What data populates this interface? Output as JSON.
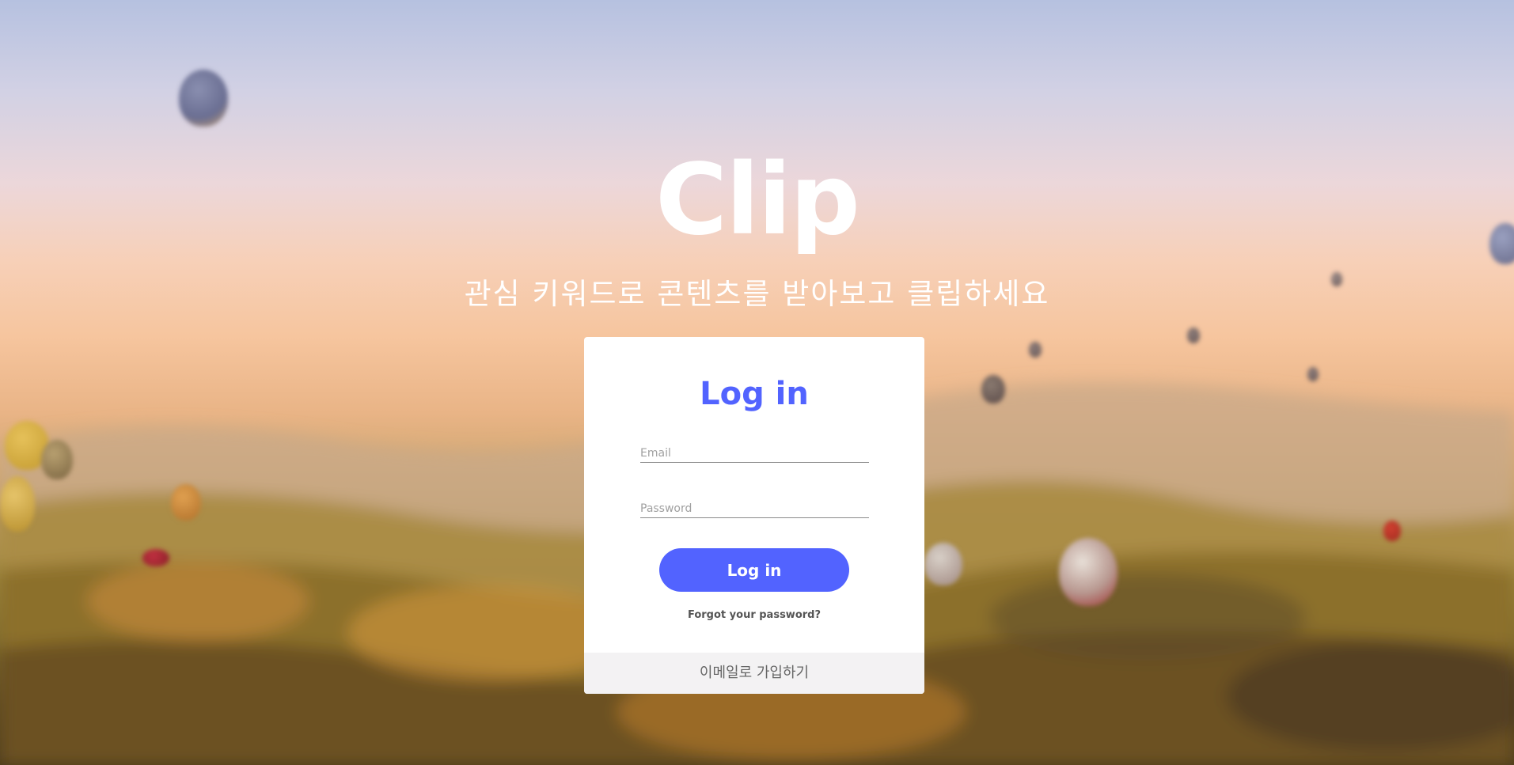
{
  "app": {
    "title": "Clip",
    "tagline": "관심 키워드로 콘텐츠를 받아보고 클립하세요"
  },
  "login_card": {
    "heading": "Log in",
    "email_placeholder": "Email",
    "password_placeholder": "Password",
    "submit_label": "Log in",
    "forgot_link": "Forgot your password?",
    "signup_label": "이메일로 가입하기"
  },
  "colors": {
    "accent": "#5263ff",
    "card_background": "#ffffff",
    "signup_background": "#f3f2f3"
  }
}
